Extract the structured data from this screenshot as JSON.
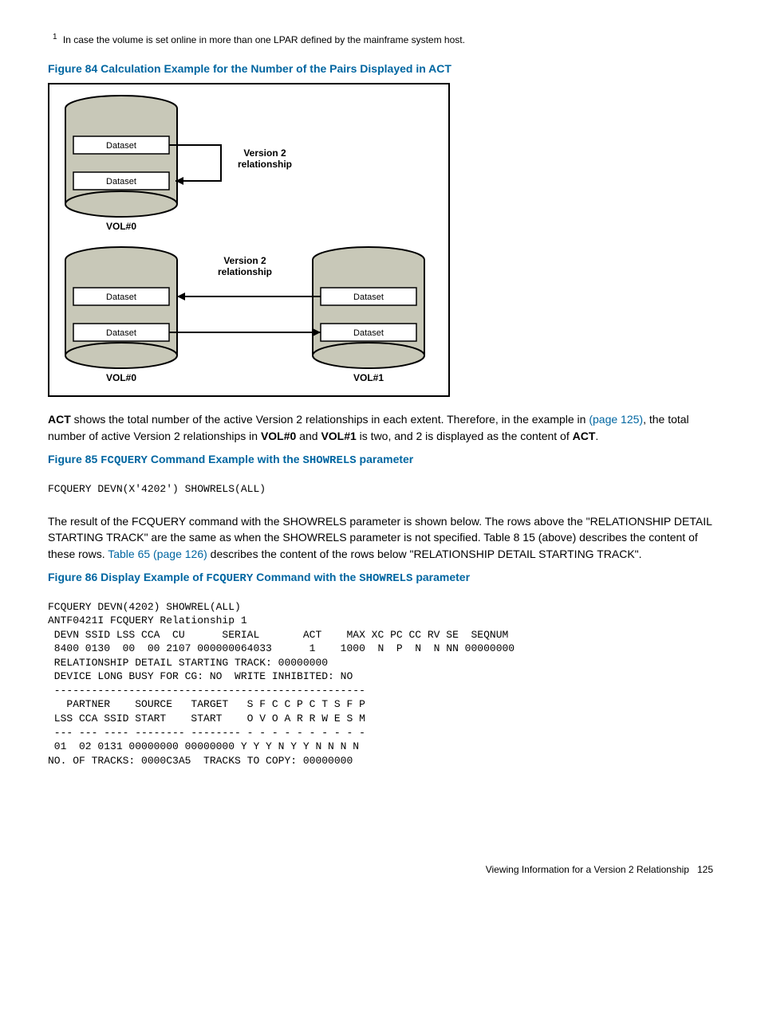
{
  "footnote": {
    "num": "1",
    "text": "In case the volume is set online in more than one LPAR defined by the mainframe system host."
  },
  "fig84_title": "Figure 84 Calculation Example for the Number of the Pairs Displayed in ACT",
  "diagram": {
    "dataset": "Dataset",
    "version2": "Version 2",
    "relationship": "relationship",
    "vol0": "VOL#0",
    "vol1": "VOL#1"
  },
  "para1": {
    "pre_bold": "",
    "bold1": "ACT",
    "mid1": " shows the total number of the active Version 2 relationships in each extent. Therefore, in the example in ",
    "link1": "(page 125)",
    "mid2": ", the total number of active Version 2 relationships in ",
    "bold2": "VOL#0",
    "mid3": " and ",
    "bold3": "VOL#1",
    "mid4": " is two, and 2 is displayed as the content of ",
    "bold4": "ACT",
    "tail": "."
  },
  "fig85": {
    "prefix": "Figure 85 ",
    "mono1": "FCQUERY",
    "mid": " Command Example with the ",
    "mono2": "SHOWRELS",
    "suffix": " parameter"
  },
  "code85": "FCQUERY DEVN(X'4202') SHOWRELS(ALL)",
  "para2": {
    "t1": "The result of the FCQUERY command with the SHOWRELS parameter is shown below. The rows above the \"RELATIONSHIP DETAIL STARTING TRACK\" are the same as when the SHOWRELS parameter is not specified. Table 8 15 (above) describes the content of these rows. ",
    "link": "Table 65 (page 126)",
    "t2": " describes the content of the rows below \"RELATIONSHIP DETAIL STARTING TRACK\"."
  },
  "fig86": {
    "prefix": "Figure 86 Display Example of ",
    "mono1": "FCQUERY",
    "mid": " Command with the ",
    "mono2": "SHOWRELS",
    "suffix": " parameter"
  },
  "code86": "FCQUERY DEVN(4202) SHOWREL(ALL)\nANTF0421I FCQUERY Relationship 1\n DEVN SSID LSS CCA  CU      SERIAL       ACT    MAX XC PC CC RV SE  SEQNUM\n 8400 0130  00  00 2107 000000064033      1    1000  N  P  N  N NN 00000000\n RELATIONSHIP DETAIL STARTING TRACK: 00000000\n DEVICE LONG BUSY FOR CG: NO  WRITE INHIBITED: NO\n --------------------------------------------------\n   PARTNER    SOURCE   TARGET   S F C C P C T S F P\n LSS CCA SSID START    START    O V O A R R W E S M\n --- --- ---- -------- -------- - - - - - - - - - -\n 01  02 0131 00000000 00000000 Y Y Y N Y Y N N N N\nNO. OF TRACKS: 0000C3A5  TRACKS TO COPY: 00000000",
  "footer": {
    "text": "Viewing Information for a Version 2 Relationship",
    "page": "125"
  }
}
